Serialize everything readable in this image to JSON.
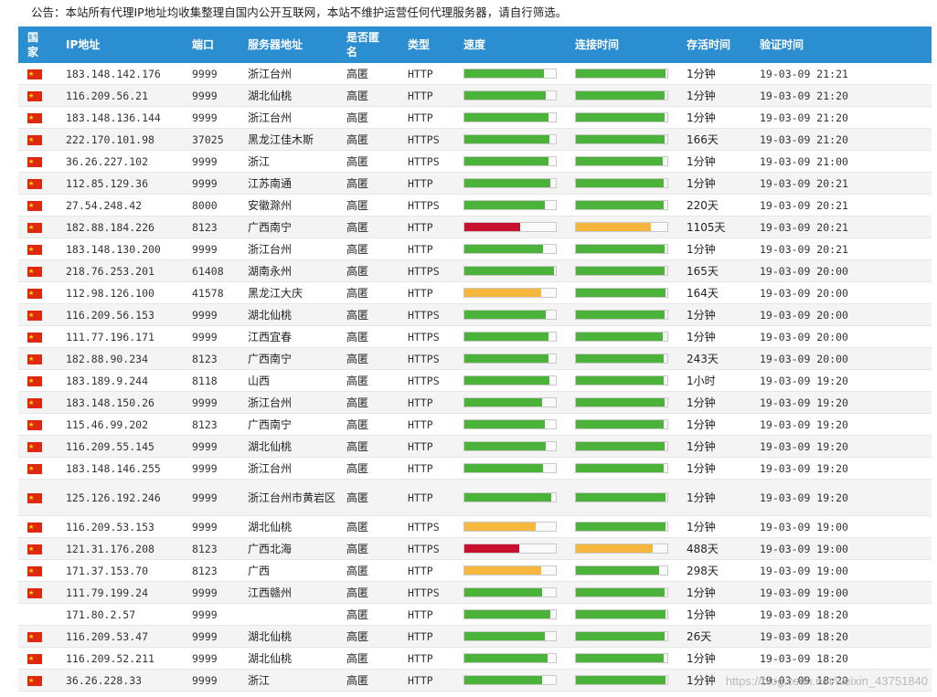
{
  "notice": "公告：本站所有代理IP地址均收集整理自国内公开互联网，本站不维护运营任何代理服务器，请自行筛选。",
  "headers": {
    "country": "国\n家",
    "ip": "IP地址",
    "port": "端口",
    "location": "服务器地址",
    "anon": "是否匿\n名",
    "type": "类型",
    "speed": "速度",
    "connect": "连接时间",
    "alive": "存活时间",
    "verified": "验证时间"
  },
  "colors": {
    "header_bg": "#2b8ed0",
    "bar_good": "#4bb33a",
    "bar_medium": "#f7b63e",
    "bar_slow": "#c8102e"
  },
  "rows": [
    {
      "flag": "cn-flag-icon",
      "ip": "183.148.142.176",
      "port": "9999",
      "location": "浙江台州",
      "anon": "高匿",
      "type": "HTTP",
      "speed": 0.87,
      "speed_level": "g",
      "connect": 0.98,
      "connect_level": "g",
      "alive": "1分钟",
      "verified": "19-03-09 21:21"
    },
    {
      "flag": "cn-flag-icon",
      "ip": "116.209.56.21",
      "port": "9999",
      "location": "湖北仙桃",
      "anon": "高匿",
      "type": "HTTP",
      "speed": 0.89,
      "speed_level": "g",
      "connect": 0.97,
      "connect_level": "g",
      "alive": "1分钟",
      "verified": "19-03-09 21:20"
    },
    {
      "flag": "cn-flag-icon",
      "ip": "183.148.136.144",
      "port": "9999",
      "location": "浙江台州",
      "anon": "高匿",
      "type": "HTTP",
      "speed": 0.92,
      "speed_level": "g",
      "connect": 0.97,
      "connect_level": "g",
      "alive": "1分钟",
      "verified": "19-03-09 21:20"
    },
    {
      "flag": "cn-flag-icon",
      "ip": "222.170.101.98",
      "port": "37025",
      "location": "黑龙江佳木斯",
      "anon": "高匿",
      "type": "HTTPS",
      "speed": 0.93,
      "speed_level": "g",
      "connect": 0.97,
      "connect_level": "g",
      "alive": "166天",
      "verified": "19-03-09 21:20"
    },
    {
      "flag": "cn-flag-icon",
      "ip": "36.26.227.102",
      "port": "9999",
      "location": "浙江",
      "anon": "高匿",
      "type": "HTTPS",
      "speed": 0.92,
      "speed_level": "g",
      "connect": 0.95,
      "connect_level": "g",
      "alive": "1分钟",
      "verified": "19-03-09 21:00"
    },
    {
      "flag": "cn-flag-icon",
      "ip": "112.85.129.36",
      "port": "9999",
      "location": "江苏南通",
      "anon": "高匿",
      "type": "HTTP",
      "speed": 0.94,
      "speed_level": "g",
      "connect": 0.96,
      "connect_level": "g",
      "alive": "1分钟",
      "verified": "19-03-09 20:21"
    },
    {
      "flag": "cn-flag-icon",
      "ip": "27.54.248.42",
      "port": "8000",
      "location": "安徽滁州",
      "anon": "高匿",
      "type": "HTTPS",
      "speed": 0.88,
      "speed_level": "g",
      "connect": 0.96,
      "connect_level": "g",
      "alive": "220天",
      "verified": "19-03-09 20:21"
    },
    {
      "flag": "cn-flag-icon",
      "ip": "182.88.184.226",
      "port": "8123",
      "location": "广西南宁",
      "anon": "高匿",
      "type": "HTTP",
      "speed": 0.61,
      "speed_level": "r",
      "connect": 0.82,
      "connect_level": "o",
      "alive": "1105天",
      "verified": "19-03-09 20:21"
    },
    {
      "flag": "cn-flag-icon",
      "ip": "183.148.130.200",
      "port": "9999",
      "location": "浙江台州",
      "anon": "高匿",
      "type": "HTTP",
      "speed": 0.86,
      "speed_level": "g",
      "connect": 0.97,
      "connect_level": "g",
      "alive": "1分钟",
      "verified": "19-03-09 20:21"
    },
    {
      "flag": "cn-flag-icon",
      "ip": "218.76.253.201",
      "port": "61408",
      "location": "湖南永州",
      "anon": "高匿",
      "type": "HTTPS",
      "speed": 0.98,
      "speed_level": "g",
      "connect": 0.97,
      "connect_level": "g",
      "alive": "165天",
      "verified": "19-03-09 20:00"
    },
    {
      "flag": "cn-flag-icon",
      "ip": "112.98.126.100",
      "port": "41578",
      "location": "黑龙江大庆",
      "anon": "高匿",
      "type": "HTTP",
      "speed": 0.84,
      "speed_level": "o",
      "connect": 0.98,
      "connect_level": "g",
      "alive": "164天",
      "verified": "19-03-09 20:00"
    },
    {
      "flag": "cn-flag-icon",
      "ip": "116.209.56.153",
      "port": "9999",
      "location": "湖北仙桃",
      "anon": "高匿",
      "type": "HTTPS",
      "speed": 0.89,
      "speed_level": "g",
      "connect": 0.97,
      "connect_level": "g",
      "alive": "1分钟",
      "verified": "19-03-09 20:00"
    },
    {
      "flag": "cn-flag-icon",
      "ip": "111.77.196.171",
      "port": "9999",
      "location": "江西宜春",
      "anon": "高匿",
      "type": "HTTPS",
      "speed": 0.92,
      "speed_level": "g",
      "connect": 0.95,
      "connect_level": "g",
      "alive": "1分钟",
      "verified": "19-03-09 20:00"
    },
    {
      "flag": "cn-flag-icon",
      "ip": "182.88.90.234",
      "port": "8123",
      "location": "广西南宁",
      "anon": "高匿",
      "type": "HTTPS",
      "speed": 0.92,
      "speed_level": "g",
      "connect": 0.96,
      "connect_level": "g",
      "alive": "243天",
      "verified": "19-03-09 20:00"
    },
    {
      "flag": "cn-flag-icon",
      "ip": "183.189.9.244",
      "port": "8118",
      "location": "山西",
      "anon": "高匿",
      "type": "HTTPS",
      "speed": 0.93,
      "speed_level": "g",
      "connect": 0.96,
      "connect_level": "g",
      "alive": "1小时",
      "verified": "19-03-09 19:20"
    },
    {
      "flag": "cn-flag-icon",
      "ip": "183.148.150.26",
      "port": "9999",
      "location": "浙江台州",
      "anon": "高匿",
      "type": "HTTP",
      "speed": 0.85,
      "speed_level": "g",
      "connect": 0.97,
      "connect_level": "g",
      "alive": "1分钟",
      "verified": "19-03-09 19:20"
    },
    {
      "flag": "cn-flag-icon",
      "ip": "115.46.99.202",
      "port": "8123",
      "location": "广西南宁",
      "anon": "高匿",
      "type": "HTTP",
      "speed": 0.88,
      "speed_level": "g",
      "connect": 0.96,
      "connect_level": "g",
      "alive": "1分钟",
      "verified": "19-03-09 19:20"
    },
    {
      "flag": "cn-flag-icon",
      "ip": "116.209.55.145",
      "port": "9999",
      "location": "湖北仙桃",
      "anon": "高匿",
      "type": "HTTP",
      "speed": 0.89,
      "speed_level": "g",
      "connect": 0.97,
      "connect_level": "g",
      "alive": "1分钟",
      "verified": "19-03-09 19:20"
    },
    {
      "flag": "cn-flag-icon",
      "ip": "183.148.146.255",
      "port": "9999",
      "location": "浙江台州",
      "anon": "高匿",
      "type": "HTTP",
      "speed": 0.86,
      "speed_level": "g",
      "connect": 0.96,
      "connect_level": "g",
      "alive": "1分钟",
      "verified": "19-03-09 19:20"
    },
    {
      "flag": "cn-flag-icon",
      "ip": "125.126.192.246",
      "port": "9999",
      "location": "浙江台州市黄岩区",
      "anon": "高匿",
      "type": "HTTP",
      "speed": 0.95,
      "speed_level": "g",
      "connect": 0.98,
      "connect_level": "g",
      "alive": "1分钟",
      "verified": "19-03-09 19:20",
      "tall": true
    },
    {
      "flag": "cn-flag-icon",
      "ip": "116.209.53.153",
      "port": "9999",
      "location": "湖北仙桃",
      "anon": "高匿",
      "type": "HTTPS",
      "speed": 0.78,
      "speed_level": "o",
      "connect": 0.98,
      "connect_level": "g",
      "alive": "1分钟",
      "verified": "19-03-09 19:00"
    },
    {
      "flag": "cn-flag-icon",
      "ip": "121.31.176.208",
      "port": "8123",
      "location": "广西北海",
      "anon": "高匿",
      "type": "HTTPS",
      "speed": 0.6,
      "speed_level": "r",
      "connect": 0.84,
      "connect_level": "o",
      "alive": "488天",
      "verified": "19-03-09 19:00"
    },
    {
      "flag": "cn-flag-icon",
      "ip": "171.37.153.70",
      "port": "8123",
      "location": "广西",
      "anon": "高匿",
      "type": "HTTP",
      "speed": 0.84,
      "speed_level": "o",
      "connect": 0.91,
      "connect_level": "g",
      "alive": "298天",
      "verified": "19-03-09 19:00"
    },
    {
      "flag": "cn-flag-icon",
      "ip": "111.79.199.24",
      "port": "9999",
      "location": "江西赣州",
      "anon": "高匿",
      "type": "HTTPS",
      "speed": 0.85,
      "speed_level": "g",
      "connect": 0.97,
      "connect_level": "g",
      "alive": "1分钟",
      "verified": "19-03-09 19:00"
    },
    {
      "flag": "",
      "ip": "171.80.2.57",
      "port": "9999",
      "location": "",
      "anon": "高匿",
      "type": "HTTP",
      "speed": 0.94,
      "speed_level": "g",
      "connect": 0.98,
      "connect_level": "g",
      "alive": "1分钟",
      "verified": "19-03-09 18:20"
    },
    {
      "flag": "cn-flag-icon",
      "ip": "116.209.53.47",
      "port": "9999",
      "location": "湖北仙桃",
      "anon": "高匿",
      "type": "HTTP",
      "speed": 0.88,
      "speed_level": "g",
      "connect": 0.97,
      "connect_level": "g",
      "alive": "26天",
      "verified": "19-03-09 18:20"
    },
    {
      "flag": "cn-flag-icon",
      "ip": "116.209.52.211",
      "port": "9999",
      "location": "湖北仙桃",
      "anon": "高匿",
      "type": "HTTP",
      "speed": 0.91,
      "speed_level": "g",
      "connect": 0.96,
      "connect_level": "g",
      "alive": "1分钟",
      "verified": "19-03-09 18:20"
    },
    {
      "flag": "cn-flag-icon",
      "ip": "36.26.228.33",
      "port": "9999",
      "location": "浙江",
      "anon": "高匿",
      "type": "HTTP",
      "speed": 0.85,
      "speed_level": "g",
      "connect": 0.98,
      "connect_level": "g",
      "alive": "1分钟",
      "verified": "19-03-09 18:20"
    }
  ],
  "watermark": "https://blog.csdn.net/weixin_43751840"
}
